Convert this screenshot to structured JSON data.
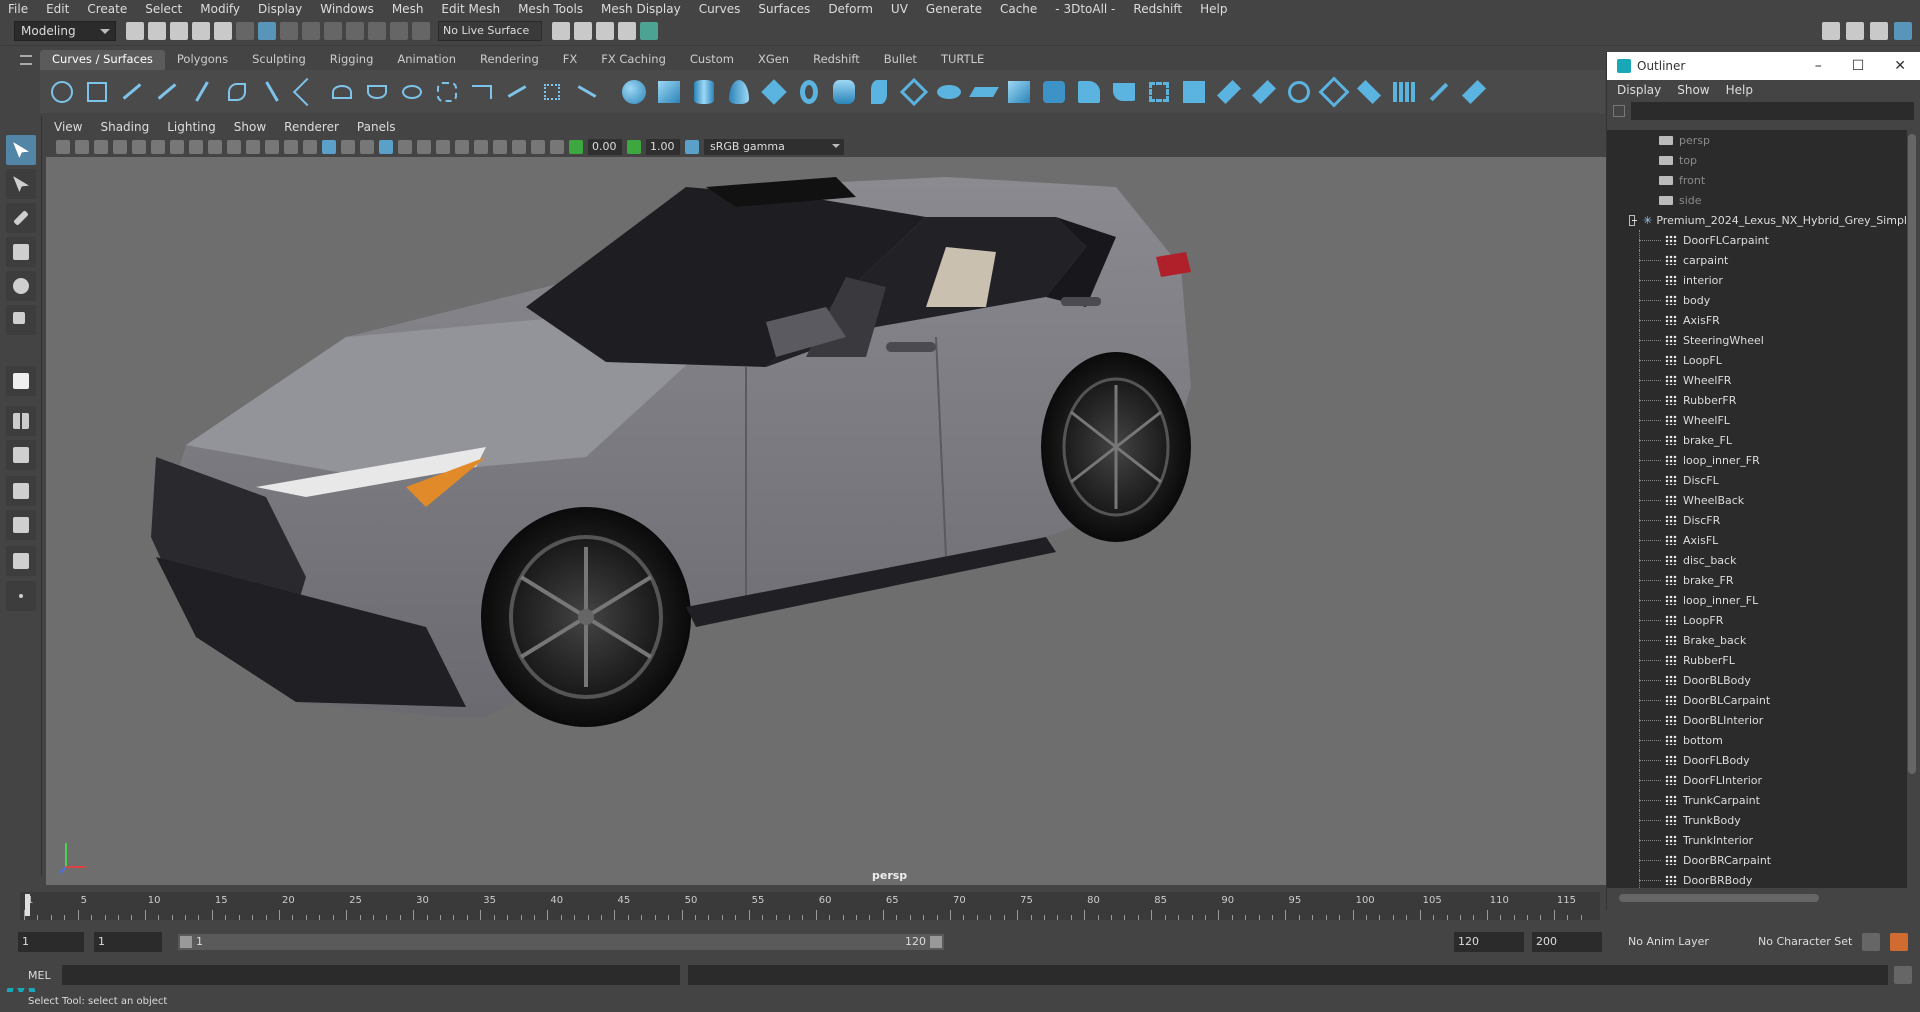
{
  "menubar": [
    "File",
    "Edit",
    "Create",
    "Select",
    "Modify",
    "Display",
    "Windows",
    "Mesh",
    "Edit Mesh",
    "Mesh Tools",
    "Mesh Display",
    "Curves",
    "Surfaces",
    "Deform",
    "UV",
    "Generate",
    "Cache",
    "- 3DtoAll -",
    "Redshift",
    "Help"
  ],
  "status": {
    "mode": "Modeling",
    "live_surface": "No Live Surface"
  },
  "shelf_tabs": [
    "Curves / Surfaces",
    "Polygons",
    "Sculpting",
    "Rigging",
    "Animation",
    "Rendering",
    "FX",
    "FX Caching",
    "Custom",
    "XGen",
    "Redshift",
    "Bullet",
    "TURTLE"
  ],
  "viewport": {
    "menu": [
      "View",
      "Shading",
      "Lighting",
      "Show",
      "Renderer",
      "Panels"
    ],
    "exposure": "0.00",
    "gamma": "1.00",
    "color_space": "sRGB gamma",
    "camera_label": "persp"
  },
  "outliner": {
    "title": "Outliner",
    "menu": [
      "Display",
      "Show",
      "Help"
    ],
    "cameras": [
      "persp",
      "top",
      "front",
      "side"
    ],
    "group": "Premium_2024_Lexus_NX_Hybrid_Grey_Simpl",
    "children": [
      "DoorFLCarpaint",
      "carpaint",
      "interior",
      "body",
      "AxisFR",
      "SteeringWheel",
      "LoopFL",
      "WheelFR",
      "RubberFR",
      "WheelFL",
      "brake_FL",
      "loop_inner_FR",
      "DiscFL",
      "WheelBack",
      "DiscFR",
      "AxisFL",
      "disc_back",
      "brake_FR",
      "loop_inner_FL",
      "LoopFR",
      "Brake_back",
      "RubberFL",
      "DoorBLBody",
      "DoorBLCarpaint",
      "DoorBLInterior",
      "bottom",
      "DoorFLBody",
      "DoorFLInterior",
      "TrunkCarpaint",
      "TrunkBody",
      "TrunkInterior",
      "DoorBRCarpaint",
      "DoorBRBody"
    ]
  },
  "timeline": {
    "ticks": [
      "1",
      "5",
      "10",
      "15",
      "20",
      "25",
      "30",
      "35",
      "40",
      "45",
      "50",
      "55",
      "60",
      "65",
      "70",
      "75",
      "80",
      "85",
      "90",
      "95",
      "100",
      "105",
      "110",
      "115"
    ]
  },
  "range": {
    "start": "1",
    "start2": "1",
    "slider_start": "1",
    "slider_end": "120",
    "end": "120",
    "end2": "200",
    "anim_layer": "No Anim Layer",
    "char_set": "No Character Set"
  },
  "mel": {
    "label": "MEL"
  },
  "help_line": "Select Tool: select an object"
}
